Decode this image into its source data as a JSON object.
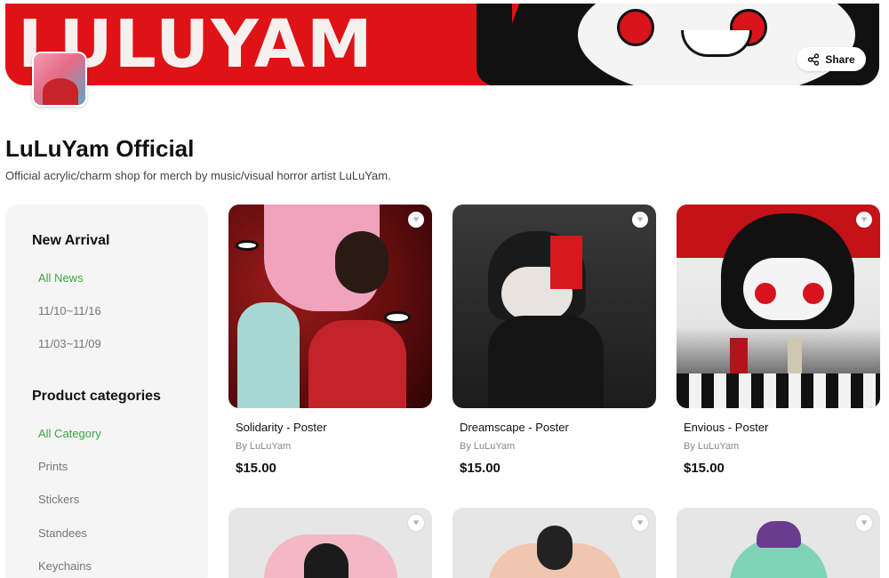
{
  "banner": {
    "title": "LULUYAM"
  },
  "header": {
    "share_label": "Share"
  },
  "shop": {
    "name": "LuLuYam Official",
    "description": "Official acrylic/charm shop for merch by music/visual horror artist LuLuYam."
  },
  "sidebar": {
    "new_arrival_heading": "New Arrival",
    "new_arrival_items": [
      "All News",
      "11/10~11/16",
      "11/03~11/09"
    ],
    "categories_heading": "Product categories",
    "category_items": [
      "All Category",
      "Prints",
      "Stickers",
      "Standees",
      "Keychains"
    ]
  },
  "products": [
    {
      "name": "Solidarity - Poster",
      "by": "By LuLuYam",
      "price": "$15.00"
    },
    {
      "name": "Dreamscape - Poster",
      "by": "By LuLuYam",
      "price": "$15.00"
    },
    {
      "name": "Envious - Poster",
      "by": "By LuLuYam",
      "price": "$15.00"
    }
  ],
  "icons": {
    "share": "share-icon",
    "favorite": "heart-icon"
  },
  "colors": {
    "accent_green": "#3aa73f",
    "banner_red": "#e01216"
  }
}
